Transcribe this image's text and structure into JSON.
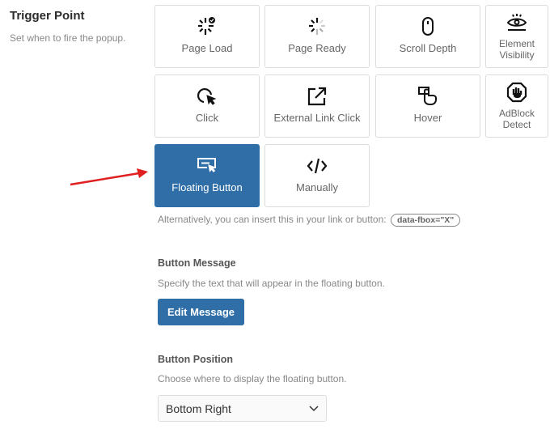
{
  "section": {
    "title": "Trigger Point",
    "subtitle": "Set when to fire the popup."
  },
  "triggers": [
    {
      "label": "Page Load",
      "icon": "page-load-icon",
      "active": false
    },
    {
      "label": "Page Ready",
      "icon": "page-ready-icon",
      "active": false
    },
    {
      "label": "Scroll Depth",
      "icon": "mouse-icon",
      "active": false
    },
    {
      "label": "Element Visibility",
      "icon": "eye-icon",
      "active": false
    },
    {
      "label": "Click",
      "icon": "cursor-click-icon",
      "active": false
    },
    {
      "label": "External Link Click",
      "icon": "external-link-icon",
      "active": false
    },
    {
      "label": "Hover",
      "icon": "hover-hand-icon",
      "active": false
    },
    {
      "label": "AdBlock Detect",
      "icon": "stop-hand-icon",
      "active": false
    },
    {
      "label": "Floating Button",
      "icon": "floating-button-icon",
      "active": true
    },
    {
      "label": "Manually",
      "icon": "code-icon",
      "active": false
    }
  ],
  "hint": {
    "text": "Alternatively, you can insert this in your link or button:",
    "code": "data-fbox=\"X\""
  },
  "button_message": {
    "title": "Button Message",
    "description": "Specify the text that will appear in the floating button.",
    "button_label": "Edit Message"
  },
  "button_position": {
    "title": "Button Position",
    "description": "Choose where to display the floating button.",
    "selected": "Bottom Right"
  },
  "colors": {
    "accent": "#2f6ea7",
    "arrow": "#e02020"
  }
}
